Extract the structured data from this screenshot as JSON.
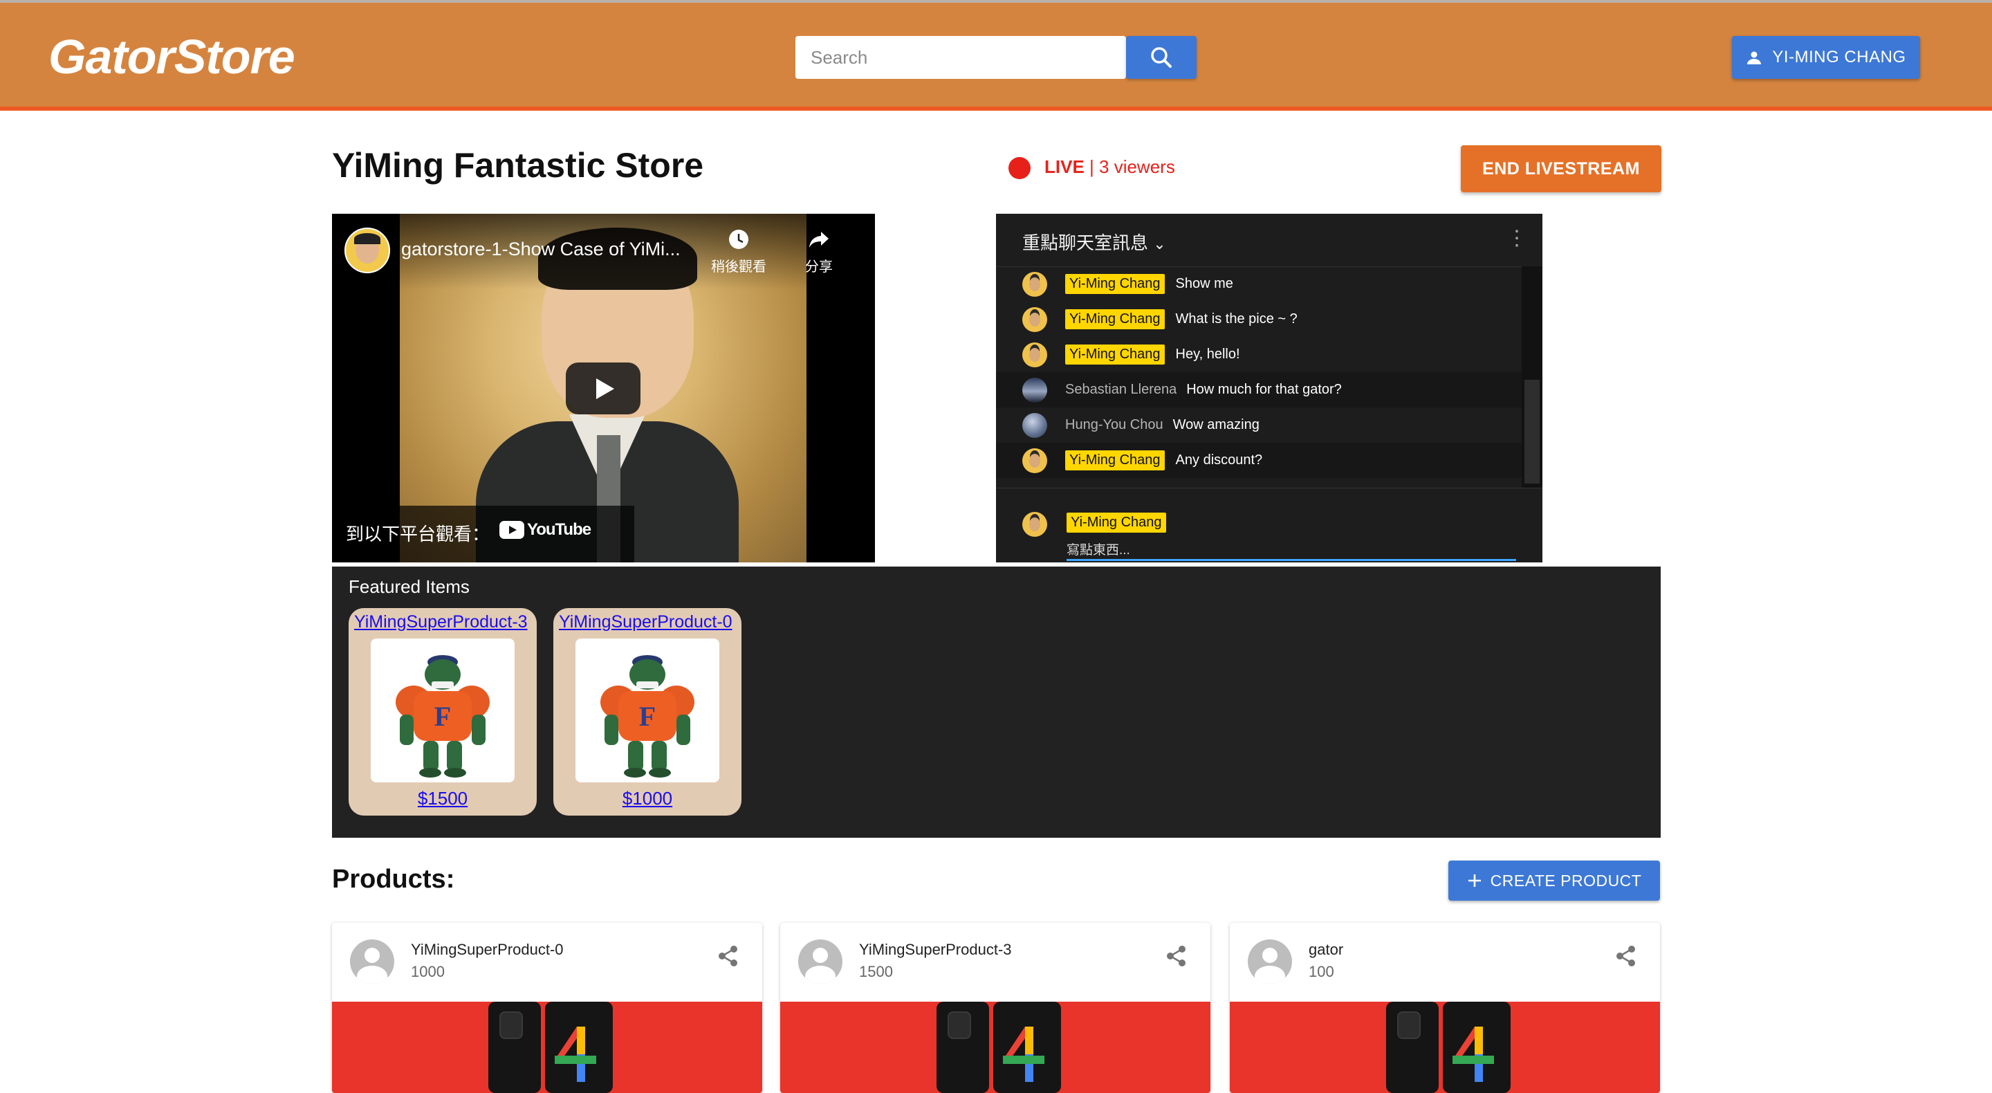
{
  "header": {
    "logo": "GatorStore",
    "search_placeholder": "Search",
    "search_icon": "search-icon",
    "user_icon": "person-icon",
    "user_label": "YI-MING CHANG",
    "accent_color": "#d5843f"
  },
  "store": {
    "title": "YiMing Fantastic Store",
    "live_label": "LIVE",
    "viewers": "| 3 viewers",
    "end_button": "END LIVESTREAM"
  },
  "video": {
    "title": "gatorstore-1-Show Case of YiMi...",
    "watch_later": "稍後觀看",
    "share": "分享",
    "watch_on": "到以下平台觀看：",
    "platform": "YouTube"
  },
  "chat": {
    "header": "重點聊天室訊息",
    "messages": [
      {
        "author": "Yi-Ming Chang",
        "text": "Show me",
        "owner": true
      },
      {
        "author": "Yi-Ming Chang",
        "text": "What is the pice ~ ?",
        "owner": true
      },
      {
        "author": "Yi-Ming Chang",
        "text": "Hey, hello!",
        "owner": true
      },
      {
        "author": "Sebastian Llerena",
        "text": "How much for that gator?",
        "owner": false
      },
      {
        "author": "Hung-You Chou",
        "text": "Wow amazing",
        "owner": false
      },
      {
        "author": "Yi-Ming Chang",
        "text": "Any discount?",
        "owner": true
      }
    ],
    "input_author": "Yi-Ming Chang",
    "input_placeholder": "寫點東西..."
  },
  "featured": {
    "title": "Featured Items",
    "items": [
      {
        "name": "YiMingSuperProduct-3",
        "price": "$1500"
      },
      {
        "name": "YiMingSuperProduct-0",
        "price": "$1000"
      }
    ]
  },
  "products": {
    "title": "Products:",
    "create_button": "CREATE PRODUCT",
    "items": [
      {
        "name": "YiMingSuperProduct-0",
        "price": "1000"
      },
      {
        "name": "YiMingSuperProduct-3",
        "price": "1500"
      },
      {
        "name": "gator",
        "price": "100"
      }
    ]
  }
}
